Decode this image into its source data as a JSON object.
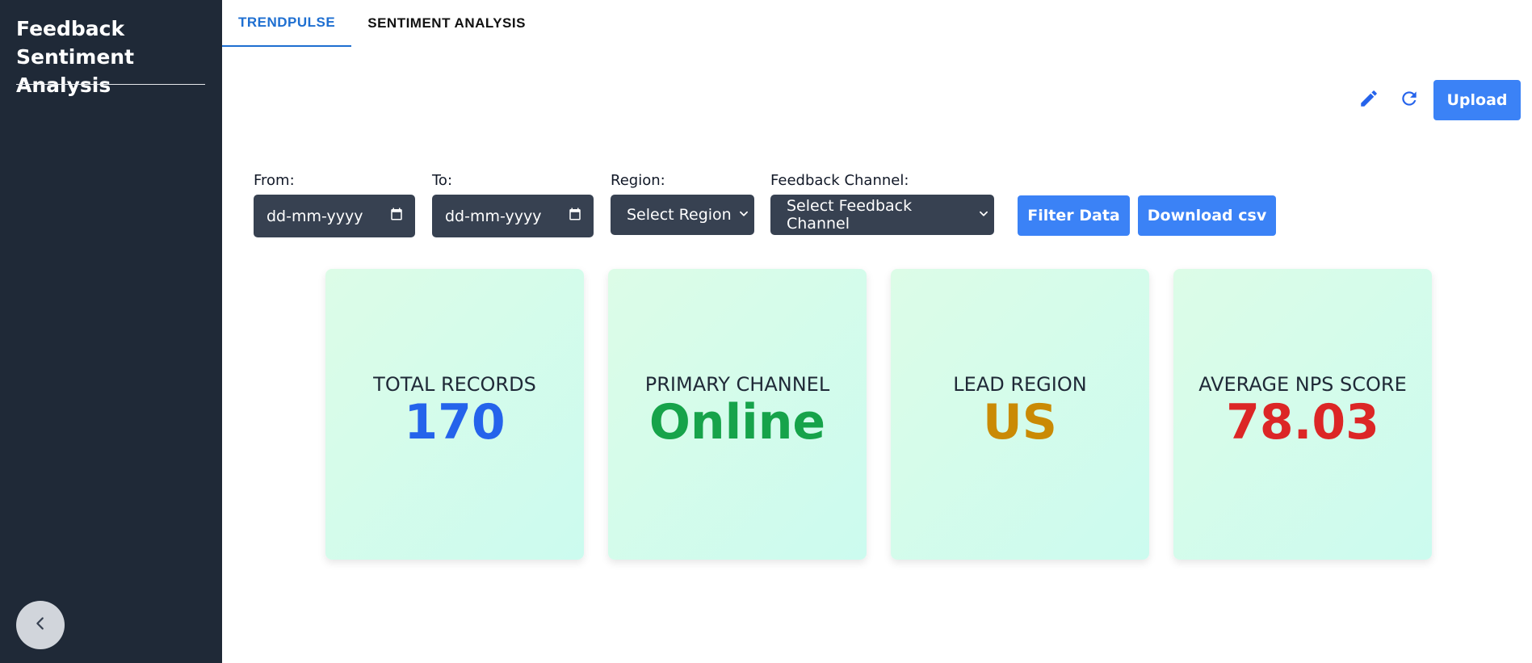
{
  "sidebar": {
    "title": "Feedback Sentiment Analysis",
    "collapse_icon": "chevron-left-icon"
  },
  "tabs": [
    {
      "label": "TRENDPULSE",
      "active": true
    },
    {
      "label": "SENTIMENT ANALYSIS",
      "active": false
    }
  ],
  "toolbar": {
    "edit_icon": "pencil-icon",
    "refresh_icon": "refresh-icon",
    "upload_label": "Upload"
  },
  "filters": {
    "from": {
      "label": "From:",
      "value": "dd-mm-yyyy"
    },
    "to": {
      "label": "To:",
      "value": "dd-mm-yyyy"
    },
    "region": {
      "label": "Region:",
      "value": "Select Region"
    },
    "channel": {
      "label": "Feedback Channel:",
      "value": "Select Feedback Channel"
    },
    "filter_label": "Filter Data",
    "download_label": "Download csv"
  },
  "cards": [
    {
      "label": "TOTAL RECORDS",
      "value": "170",
      "color": "#2563eb"
    },
    {
      "label": "PRIMARY CHANNEL",
      "value": "Online",
      "color": "#16a34a"
    },
    {
      "label": "LEAD REGION",
      "value": "US",
      "color": "#ca8a04"
    },
    {
      "label": "AVERAGE NPS SCORE",
      "value": "78.03",
      "color": "#dc2626"
    }
  ],
  "colors": {
    "sidebar_bg": "#1f2937",
    "accent": "#3b82f6",
    "tab_active": "#1e6fd1",
    "control_bg": "#374151"
  }
}
